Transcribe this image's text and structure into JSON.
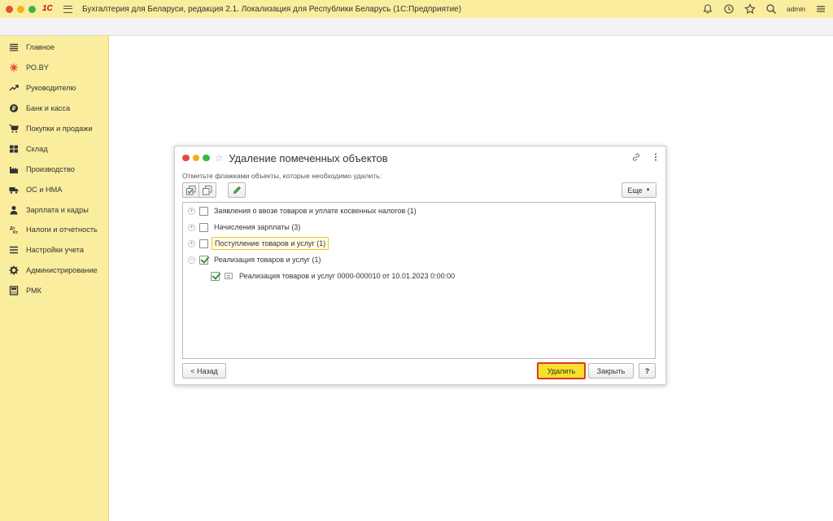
{
  "app": {
    "title": "Бухгалтерия для Беларуси, редакция 2.1. Локализация для Республики Беларусь   (1С:Предприятие)",
    "logo": "1С",
    "user": "admin",
    "icons": [
      "bell-icon",
      "history-icon",
      "star-icon",
      "search-icon"
    ]
  },
  "sidebar": {
    "items": [
      {
        "label": "Главное",
        "icon": "menu-lines-icon"
      },
      {
        "label": "РО.BY",
        "icon": "sparkle-icon"
      },
      {
        "label": "Руководителю",
        "icon": "trend-icon"
      },
      {
        "label": "Банк и касса",
        "icon": "coin-icon"
      },
      {
        "label": "Покупки и продажи",
        "icon": "cart-icon"
      },
      {
        "label": "Склад",
        "icon": "warehouse-icon"
      },
      {
        "label": "Производство",
        "icon": "factory-icon"
      },
      {
        "label": "ОС и НМА",
        "icon": "truck-icon"
      },
      {
        "label": "Зарплата и кадры",
        "icon": "person-icon"
      },
      {
        "label": "Налоги и отчетность",
        "icon": "tax-icon"
      },
      {
        "label": "Настройки учета",
        "icon": "settings-list-icon"
      },
      {
        "label": "Администрирование",
        "icon": "gear-icon"
      },
      {
        "label": "РМК",
        "icon": "register-icon"
      }
    ]
  },
  "dialog": {
    "title": "Удаление помеченных объектов",
    "hint": "Отметьте флажками объекты, которые необходимо удалить:",
    "more_label": "Еще",
    "back_label": "< Назад",
    "delete_label": "Удалить",
    "close_label": "Закрыть",
    "help_label": "?",
    "tree": [
      {
        "label": "Заявления о ввозе товаров и уплате косвенных налогов (1)",
        "checked": false,
        "expanded": false
      },
      {
        "label": "Начисления зарплаты (3)",
        "checked": false,
        "expanded": false
      },
      {
        "label": "Поступление товаров и услуг (1)",
        "checked": false,
        "expanded": false,
        "highlighted": true
      },
      {
        "label": "Реализация товаров и услуг (1)",
        "checked": true,
        "expanded": true,
        "children": [
          {
            "label": "Реализация товаров и услуг 0000-000010 от 10.01.2023 0:00:00",
            "checked": true
          }
        ]
      }
    ]
  }
}
